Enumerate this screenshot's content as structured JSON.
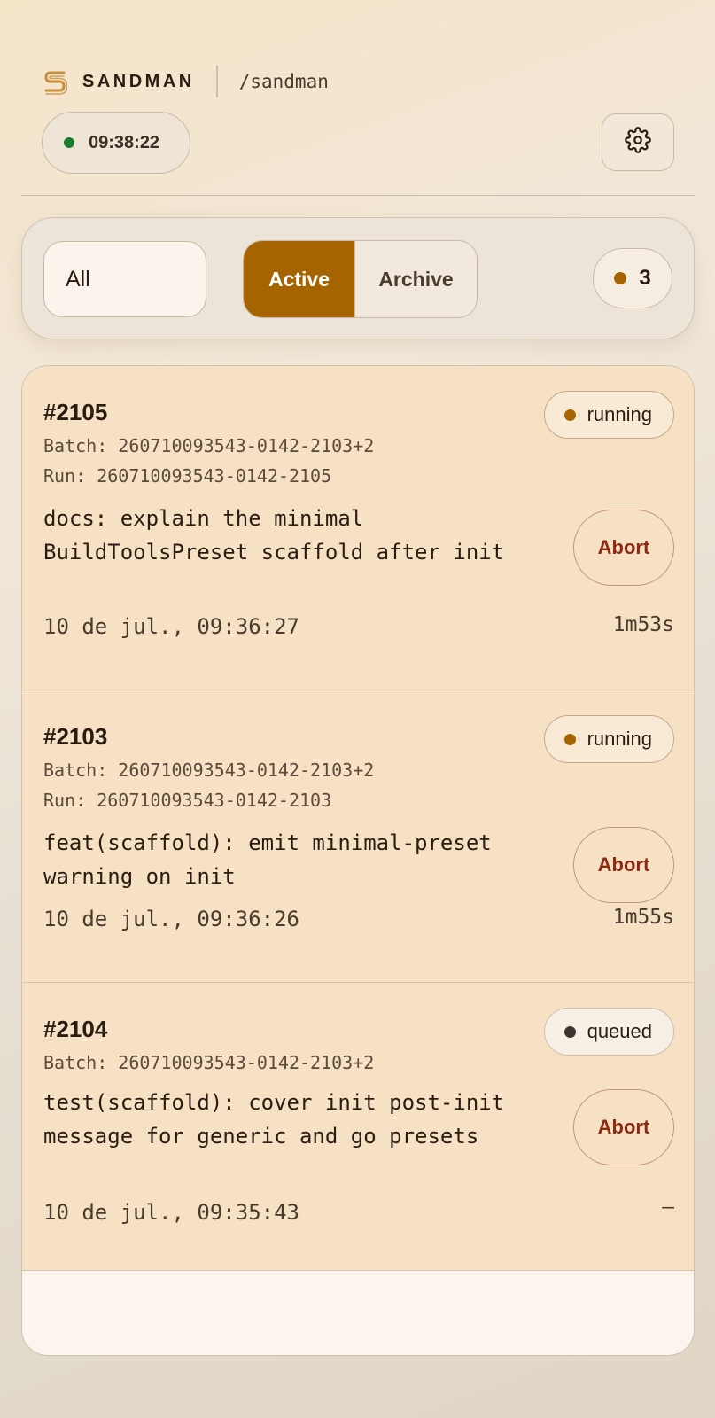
{
  "header": {
    "brand": "SANDMAN",
    "path": "/sandman",
    "clock": "09:38:22",
    "clock_status_color": "#1a7a2e"
  },
  "filters": {
    "scope_value": "All",
    "tabs": [
      {
        "label": "Active",
        "selected": true
      },
      {
        "label": "Archive",
        "selected": false
      }
    ],
    "count": "3",
    "accent_color": "#a66400"
  },
  "jobs": [
    {
      "id": "#2105",
      "status": "running",
      "status_color": "#a66400",
      "batch": "Batch: 260710093543-0142-2103+2",
      "run": "Run: 260710093543-0142-2105",
      "message": "docs: explain the minimal BuildToolsPreset scaffold after init",
      "action": "Abort",
      "time": "10 de jul., 09:36:27",
      "duration": "1m53s"
    },
    {
      "id": "#2103",
      "status": "running",
      "status_color": "#a66400",
      "batch": "Batch: 260710093543-0142-2103+2",
      "run": "Run: 260710093543-0142-2103",
      "message": "feat(scaffold): emit minimal-preset warning on init",
      "action": "Abort",
      "time": "10 de jul., 09:36:26",
      "duration": "1m55s"
    },
    {
      "id": "#2104",
      "status": "queued",
      "status_color": "#3b3530",
      "batch": "Batch: 260710093543-0142-2103+2",
      "message": "test(scaffold): cover init post-init message for generic and go presets",
      "action": "Abort",
      "time": "10 de jul., 09:35:43",
      "duration": "—"
    }
  ]
}
